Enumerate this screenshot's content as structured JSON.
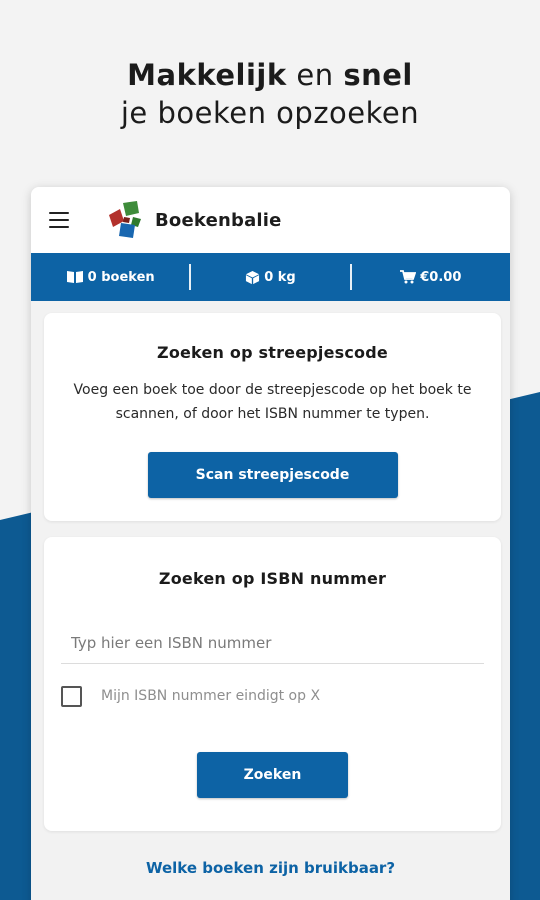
{
  "promo": {
    "line1_bold": "Makkelijk",
    "line1_middle": "en",
    "line1_bold2": "snel",
    "line2": "je boeken opzoeken"
  },
  "app": {
    "title": "Boekenbalie",
    "menu_icon": "hamburger-menu-icon",
    "logo": "boekenbalie-logo"
  },
  "status": {
    "books": "0 boeken",
    "weight": "0 kg",
    "total": "€0.00",
    "books_icon": "book-icon",
    "weight_icon": "package-icon",
    "cart_icon": "cart-icon"
  },
  "barcode_card": {
    "title": "Zoeken op streepjescode",
    "description": "Voeg een boek toe door de streepjescode op het boek te scannen, of door het ISBN nummer te typen.",
    "button": "Scan streepjescode"
  },
  "isbn_card": {
    "title": "Zoeken op ISBN nummer",
    "input_placeholder": "Typ hier een ISBN nummer",
    "input_value": "",
    "checkbox_label": "Mijn ISBN nummer eindigt op X",
    "checkbox_checked": false,
    "button": "Zoeken"
  },
  "footer_link": "Welke boeken zijn bruikbaar?",
  "colors": {
    "primary": "#0d63a5",
    "background": "#f3f3f3",
    "card": "#ffffff"
  }
}
